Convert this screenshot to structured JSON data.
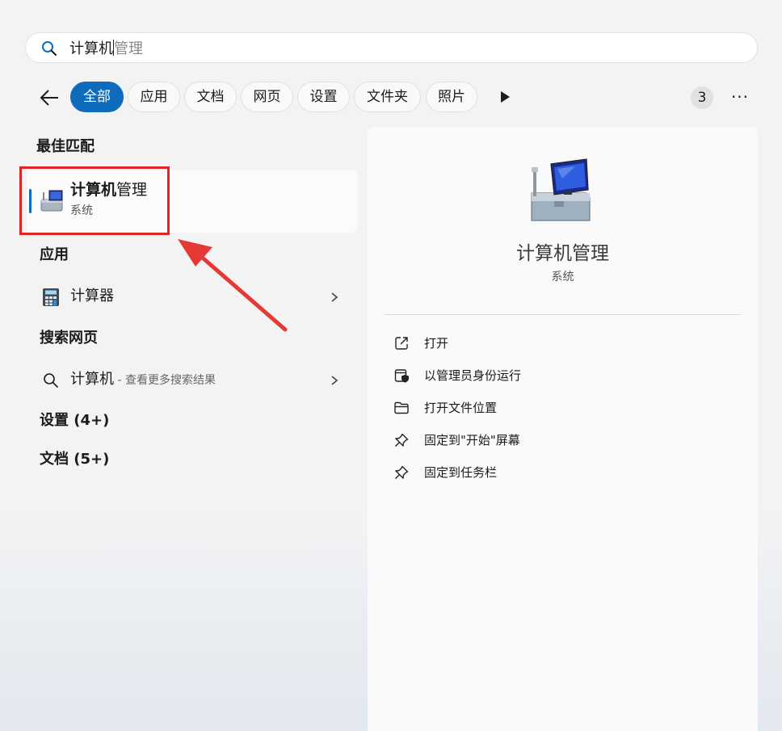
{
  "search": {
    "typed": "计算机",
    "suggestion": "管理"
  },
  "filters": {
    "chips": [
      "全部",
      "应用",
      "文档",
      "网页",
      "设置",
      "文件夹",
      "照片"
    ],
    "active": "全部",
    "count": "3",
    "more": "···"
  },
  "best_match": {
    "heading": "最佳匹配",
    "title_bold": "计算机",
    "title_rest": "管理",
    "subtitle": "系统"
  },
  "apps": {
    "heading": "应用",
    "items": [
      {
        "label": "计算器"
      }
    ]
  },
  "web": {
    "heading": "搜索网页",
    "query": "计算机",
    "hint": " - 查看更多搜索结果"
  },
  "settings_section": {
    "heading": "设置 (4+)"
  },
  "docs_section": {
    "heading": "文档 (5+)"
  },
  "detail": {
    "title": "计算机管理",
    "subtitle": "系统",
    "actions": [
      {
        "label": "打开",
        "icon": "open-external-icon"
      },
      {
        "label": "以管理员身份运行",
        "icon": "shield-icon"
      },
      {
        "label": "打开文件位置",
        "icon": "folder-icon"
      },
      {
        "label": "固定到\"开始\"屏幕",
        "icon": "pin-icon"
      },
      {
        "label": "固定到任务栏",
        "icon": "pin-icon"
      }
    ]
  },
  "colors": {
    "accent": "#0f6cbd",
    "highlight_box": "#e02424",
    "annotation_arrow": "#e53935"
  }
}
